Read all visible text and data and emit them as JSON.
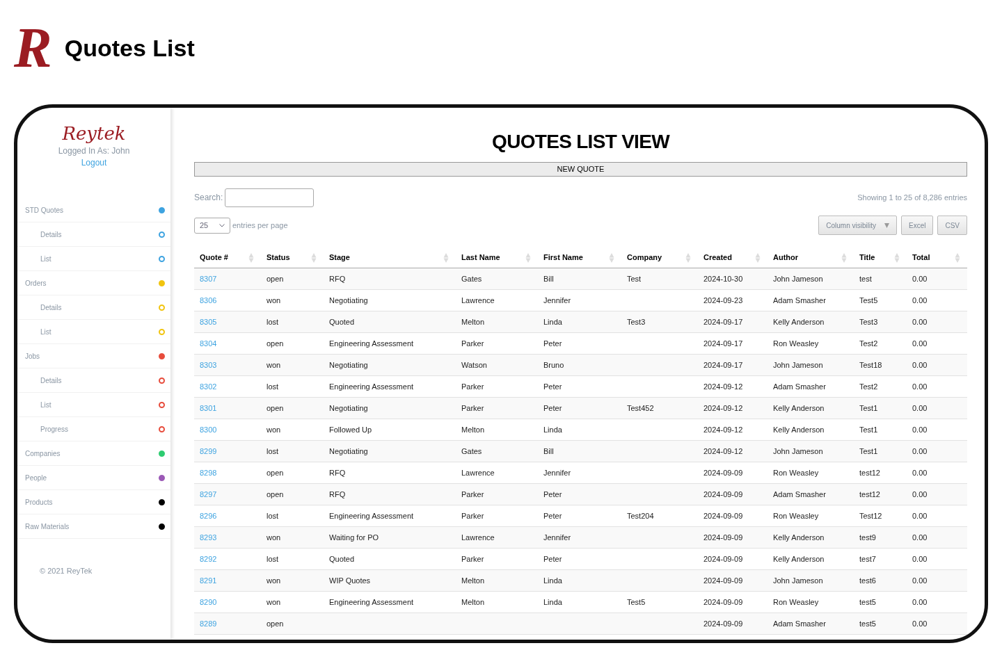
{
  "header": {
    "logo": "R",
    "title": "Quotes List"
  },
  "sidebar": {
    "logo": "Reytek",
    "logged_in": "Logged In As: John",
    "logout": "Logout",
    "footer": "© 2021 ReyTek",
    "items": [
      {
        "label": "STD Quotes",
        "color": "#3ea3e0",
        "children": [
          {
            "label": "Details",
            "color": "#3ea3e0"
          },
          {
            "label": "List",
            "color": "#3ea3e0"
          }
        ]
      },
      {
        "label": "Orders",
        "color": "#f1c40f",
        "children": [
          {
            "label": "Details",
            "color": "#f1c40f"
          },
          {
            "label": "List",
            "color": "#f1c40f"
          }
        ]
      },
      {
        "label": "Jobs",
        "color": "#e74c3c",
        "children": [
          {
            "label": "Details",
            "color": "#e74c3c"
          },
          {
            "label": "List",
            "color": "#e74c3c"
          },
          {
            "label": "Progress",
            "color": "#e74c3c"
          }
        ]
      },
      {
        "label": "Companies",
        "color": "#2ecc71"
      },
      {
        "label": "People",
        "color": "#9b59b6"
      },
      {
        "label": "Products",
        "color": "#000000"
      },
      {
        "label": "Raw Materials",
        "color": "#000000"
      }
    ]
  },
  "main": {
    "title": "QUOTES LIST VIEW",
    "new_button": "NEW QUOTE",
    "search_label": "Search:",
    "info": "Showing 1 to 25 of 8,286 entries",
    "page_size": "25",
    "page_size_suffix": "entries per page",
    "buttons": [
      {
        "label": "Column visibility",
        "kind": "dropdown"
      },
      {
        "label": "Excel",
        "kind": "plain"
      },
      {
        "label": "CSV",
        "kind": "plain"
      }
    ]
  },
  "table": {
    "columns": [
      "Quote #",
      "Status",
      "Stage",
      "Last Name",
      "First Name",
      "Company",
      "Created",
      "Author",
      "Title",
      "Total"
    ],
    "rows": [
      [
        "8307",
        "open",
        "RFQ",
        "Gates",
        "Bill",
        "Test",
        "2024-10-30",
        "John Jameson",
        "test",
        "0.00"
      ],
      [
        "8306",
        "won",
        "Negotiating",
        "Lawrence",
        "Jennifer",
        null,
        "2024-09-23",
        "Adam Smasher",
        "Test5",
        "0.00"
      ],
      [
        "8305",
        "lost",
        "Quoted",
        "Melton",
        "Linda",
        "Test3",
        "2024-09-17",
        "Kelly Anderson",
        "Test3",
        "0.00"
      ],
      [
        "8304",
        "open",
        "Engineering Assessment",
        "Parker",
        "Peter",
        null,
        "2024-09-17",
        "Ron Weasley",
        "Test2",
        "0.00"
      ],
      [
        "8303",
        "won",
        "Negotiating",
        "Watson",
        "Bruno",
        null,
        "2024-09-17",
        "John Jameson",
        "Test18",
        "0.00"
      ],
      [
        "8302",
        "lost",
        "Engineering Assessment",
        "Parker",
        "Peter",
        null,
        "2024-09-12",
        "Adam Smasher",
        "Test2",
        "0.00"
      ],
      [
        "8301",
        "open",
        "Negotiating",
        "Parker",
        "Peter",
        "Test452",
        "2024-09-12",
        "Kelly Anderson",
        "Test1",
        "0.00"
      ],
      [
        "8300",
        "won",
        "Followed Up",
        "Melton",
        "Linda",
        null,
        "2024-09-12",
        "Kelly Anderson",
        "Test1",
        "0.00"
      ],
      [
        "8299",
        "lost",
        "Negotiating",
        "Gates",
        "Bill",
        null,
        "2024-09-12",
        "John Jameson",
        "Test1",
        "0.00"
      ],
      [
        "8298",
        "open",
        "RFQ",
        "Lawrence",
        "Jennifer",
        null,
        "2024-09-09",
        "Ron Weasley",
        "test12",
        "0.00"
      ],
      [
        "8297",
        "open",
        "RFQ",
        "Parker",
        "Peter",
        null,
        "2024-09-09",
        "Adam Smasher",
        "test12",
        "0.00"
      ],
      [
        "8296",
        "lost",
        "Engineering Assessment",
        "Parker",
        "Peter",
        "Test204",
        "2024-09-09",
        "Ron Weasley",
        "Test12",
        "0.00"
      ],
      [
        "8293",
        "won",
        "Waiting for PO",
        "Lawrence",
        "Jennifer",
        null,
        "2024-09-09",
        "Kelly Anderson",
        "test9",
        "0.00"
      ],
      [
        "8292",
        "lost",
        "Quoted",
        "Parker",
        "Peter",
        null,
        "2024-09-09",
        "Kelly Anderson",
        "test7",
        "0.00"
      ],
      [
        "8291",
        "won",
        "WIP Quotes",
        "Melton",
        "Linda",
        null,
        "2024-09-09",
        "John Jameson",
        "test6",
        "0.00"
      ],
      [
        "8290",
        "won",
        "Engineering Assessment",
        "Melton",
        "Linda",
        "Test5",
        "2024-09-09",
        "Ron Weasley",
        "test5",
        "0.00"
      ],
      [
        "8289",
        "open",
        null,
        null,
        null,
        null,
        "2024-09-09",
        "Adam Smasher",
        "test5",
        "0.00"
      ]
    ]
  }
}
